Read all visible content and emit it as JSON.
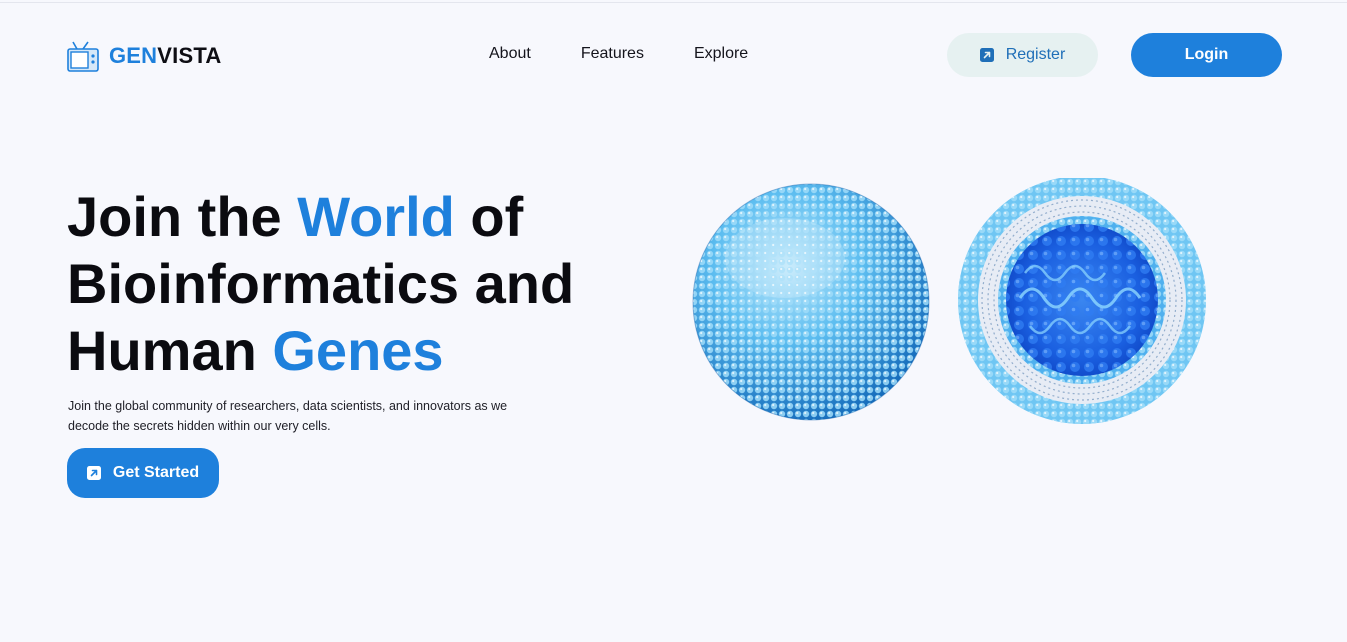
{
  "brand": {
    "name_accent": "GEN",
    "name_rest": "VISTA",
    "icon": "tv-icon",
    "accent_color": "#1e80dc"
  },
  "nav": {
    "items": [
      "About",
      "Features",
      "Explore"
    ]
  },
  "auth": {
    "register_label": "Register",
    "login_label": "Login"
  },
  "hero": {
    "title": {
      "part1": "Join the ",
      "highlight1": "World",
      "part2": " of Bioinformatics and Human ",
      "highlight2": "Genes"
    },
    "subtitle": "Join the global community of researchers, data scientists, and innovators as we decode the secrets hidden within our very cells.",
    "cta_label": "Get Started",
    "cta_icon": "arrow-up-right-icon",
    "image": "liposome-illustration"
  },
  "colors": {
    "primary": "#1e80dc",
    "register_bg": "#e6f1f1",
    "page_bg": "#f7f8fd"
  }
}
